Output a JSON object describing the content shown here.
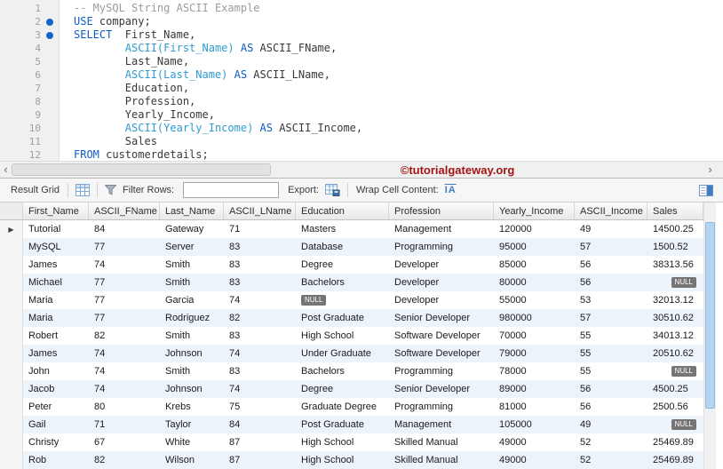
{
  "watermark": "©tutorialgateway.org",
  "editor": {
    "lines": [
      {
        "num": 1,
        "marker": false,
        "segments": [
          {
            "type": "comment",
            "text": "-- MySQL String ASCII Example"
          }
        ]
      },
      {
        "num": 2,
        "marker": true,
        "segments": [
          {
            "type": "keyword",
            "text": "USE"
          },
          {
            "type": "plain",
            "text": " company;"
          }
        ]
      },
      {
        "num": 3,
        "marker": true,
        "segments": [
          {
            "type": "keyword",
            "text": "SELECT"
          },
          {
            "type": "plain",
            "text": "  First_Name,"
          }
        ]
      },
      {
        "num": 4,
        "marker": false,
        "segments": [
          {
            "type": "plain",
            "text": "        "
          },
          {
            "type": "function",
            "text": "ASCII(First_Name)"
          },
          {
            "type": "plain",
            "text": " "
          },
          {
            "type": "keyword",
            "text": "AS"
          },
          {
            "type": "plain",
            "text": " ASCII_FName,"
          }
        ]
      },
      {
        "num": 5,
        "marker": false,
        "segments": [
          {
            "type": "plain",
            "text": "        Last_Name,"
          }
        ]
      },
      {
        "num": 6,
        "marker": false,
        "segments": [
          {
            "type": "plain",
            "text": "        "
          },
          {
            "type": "function",
            "text": "ASCII(Last_Name)"
          },
          {
            "type": "plain",
            "text": " "
          },
          {
            "type": "keyword",
            "text": "AS"
          },
          {
            "type": "plain",
            "text": " ASCII_LName,"
          }
        ]
      },
      {
        "num": 7,
        "marker": false,
        "segments": [
          {
            "type": "plain",
            "text": "        Education,"
          }
        ]
      },
      {
        "num": 8,
        "marker": false,
        "segments": [
          {
            "type": "plain",
            "text": "        Profession,"
          }
        ]
      },
      {
        "num": 9,
        "marker": false,
        "segments": [
          {
            "type": "plain",
            "text": "        Yearly_Income,"
          }
        ]
      },
      {
        "num": 10,
        "marker": false,
        "segments": [
          {
            "type": "plain",
            "text": "        "
          },
          {
            "type": "function",
            "text": "ASCII(Yearly_Income)"
          },
          {
            "type": "plain",
            "text": " "
          },
          {
            "type": "keyword",
            "text": "AS"
          },
          {
            "type": "plain",
            "text": " ASCII_Income,"
          }
        ]
      },
      {
        "num": 11,
        "marker": false,
        "segments": [
          {
            "type": "plain",
            "text": "        Sales"
          }
        ]
      },
      {
        "num": 12,
        "marker": false,
        "segments": [
          {
            "type": "keyword",
            "text": "FROM"
          },
          {
            "type": "plain",
            "text": " customerdetails;"
          }
        ]
      }
    ]
  },
  "toolbar": {
    "result_grid_label": "Result Grid",
    "filter_label": "Filter Rows:",
    "filter_value": "",
    "export_label": "Export:",
    "wrap_label": "Wrap Cell Content:"
  },
  "table": {
    "columns": [
      "First_Name",
      "ASCII_FName",
      "Last_Name",
      "ASCII_LName",
      "Education",
      "Profession",
      "Yearly_Income",
      "ASCII_Income",
      "Sales"
    ],
    "rows": [
      [
        "Tutorial",
        "84",
        "Gateway",
        "71",
        "Masters",
        "Management",
        "120000",
        "49",
        "14500.25"
      ],
      [
        "MySQL",
        "77",
        "Server",
        "83",
        "Database",
        "Programming",
        "95000",
        "57",
        "1500.52"
      ],
      [
        "James",
        "74",
        "Smith",
        "83",
        "Degree",
        "Developer",
        "85000",
        "56",
        "38313.56"
      ],
      [
        "Michael",
        "77",
        "Smith",
        "83",
        "Bachelors",
        "Developer",
        "80000",
        "56",
        "NULL"
      ],
      [
        "Maria",
        "77",
        "Garcia",
        "74",
        "NULL",
        "Developer",
        "55000",
        "53",
        "32013.12"
      ],
      [
        "Maria",
        "77",
        "Rodriguez",
        "82",
        "Post Graduate",
        "Senior Developer",
        "980000",
        "57",
        "30510.62"
      ],
      [
        "Robert",
        "82",
        "Smith",
        "83",
        "High School",
        "Software Developer",
        "70000",
        "55",
        "34013.12"
      ],
      [
        "James",
        "74",
        "Johnson",
        "74",
        "Under Graduate",
        "Software Developer",
        "79000",
        "55",
        "20510.62"
      ],
      [
        "John",
        "74",
        "Smith",
        "83",
        "Bachelors",
        "Programming",
        "78000",
        "55",
        "NULL"
      ],
      [
        "Jacob",
        "74",
        "Johnson",
        "74",
        "Degree",
        "Senior Developer",
        "89000",
        "56",
        "4500.25"
      ],
      [
        "Peter",
        "80",
        "Krebs",
        "75",
        "Graduate Degree",
        "Programming",
        "81000",
        "56",
        "2500.56"
      ],
      [
        "Gail",
        "71",
        "Taylor",
        "84",
        "Post Graduate",
        "Management",
        "105000",
        "49",
        "NULL"
      ],
      [
        "Christy",
        "67",
        "White",
        "87",
        "High School",
        "Skilled Manual",
        "49000",
        "52",
        "25469.89"
      ],
      [
        "Rob",
        "82",
        "Wilson",
        "87",
        "High School",
        "Skilled Manual",
        "49000",
        "52",
        "25469.89"
      ]
    ]
  }
}
